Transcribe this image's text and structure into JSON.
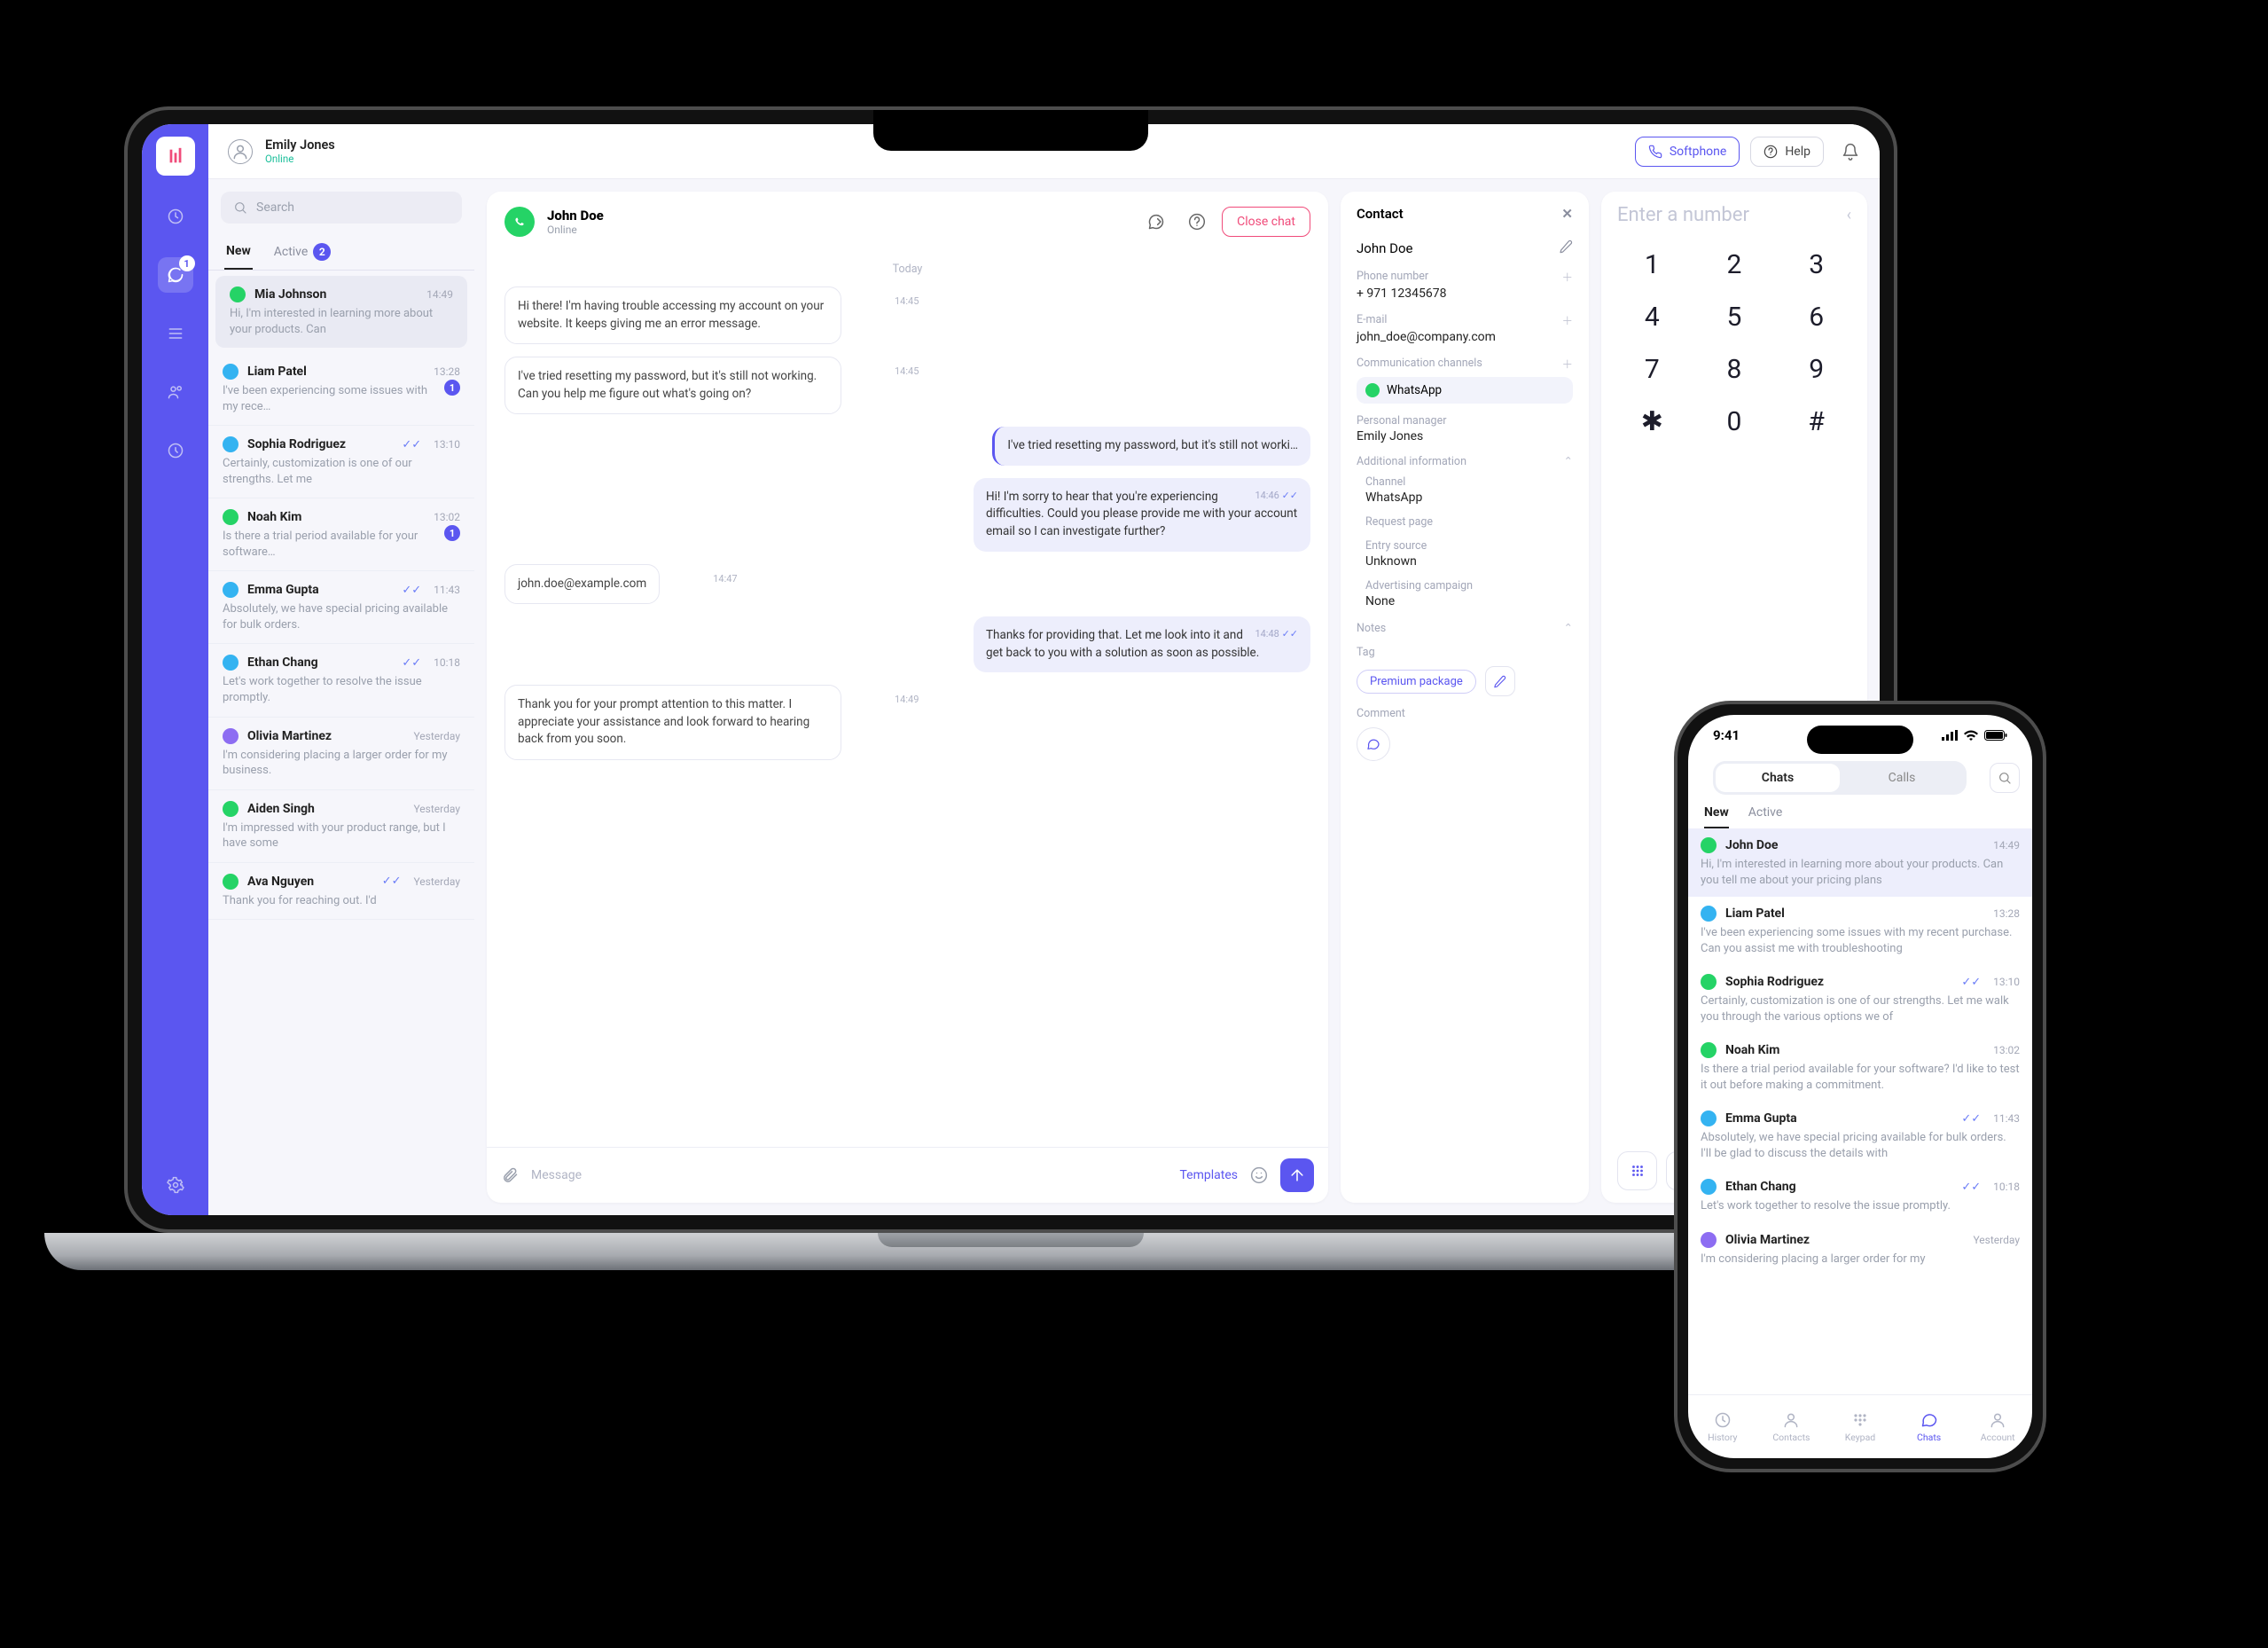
{
  "user": {
    "name": "Emily Jones",
    "status": "Online"
  },
  "topbar": {
    "softphone": "Softphone",
    "help": "Help"
  },
  "rail": {
    "badge": "1"
  },
  "search": {
    "placeholder": "Search"
  },
  "listTabs": {
    "new": "New",
    "active": "Active",
    "activeCount": "2"
  },
  "chats": [
    {
      "name": "Mia Johnson",
      "time": "14:49",
      "preview": "Hi, I'm interested in learning more about your products. Can",
      "color": "#25d366",
      "sel": true
    },
    {
      "name": "Liam Patel",
      "time": "13:28",
      "preview": "I've been experiencing some issues with my rece…",
      "color": "#34b3f1",
      "badge": "1"
    },
    {
      "name": "Sophia Rodriguez",
      "time": "13:10",
      "preview": "Certainly, customization is one of our strengths. Let me",
      "color": "#34b3f1",
      "check": true
    },
    {
      "name": "Noah Kim",
      "time": "13:02",
      "preview": "Is there a trial period available for your software…",
      "color": "#25d366",
      "badge": "1"
    },
    {
      "name": "Emma Gupta",
      "time": "11:43",
      "preview": "Absolutely, we have special pricing available for bulk orders.",
      "color": "#34b3f1",
      "check": true
    },
    {
      "name": "Ethan Chang",
      "time": "10:18",
      "preview": "Let's work together to resolve the issue promptly.",
      "color": "#34b3f1",
      "check": true
    },
    {
      "name": "Olivia Martinez",
      "time": "Yesterday",
      "preview": "I'm considering placing a larger order for my business.",
      "color": "#8d6df2"
    },
    {
      "name": "Aiden Singh",
      "time": "Yesterday",
      "preview": "I'm impressed with your product range, but I have some",
      "color": "#25d366"
    },
    {
      "name": "Ava Nguyen",
      "time": "Yesterday",
      "preview": "Thank you for reaching out. I'd",
      "color": "#25d366",
      "check": true
    }
  ],
  "chatHeader": {
    "name": "John Doe",
    "status": "Online",
    "close": "Close chat"
  },
  "daySep": "Today",
  "messages": [
    {
      "dir": "in",
      "text": "Hi there! I'm having trouble accessing my account on your website. It keeps giving me an error message.",
      "time": "14:45"
    },
    {
      "dir": "in",
      "text": "I've tried resetting my password, but it's still not working. Can you help me figure out what's going on?",
      "time": "14:45"
    },
    {
      "dir": "out",
      "text": "I've tried resetting my password, but it's still not worki…",
      "time": "",
      "bar": true
    },
    {
      "dir": "out",
      "text": "Hi! I'm sorry to hear that you're experiencing difficulties. Could you please provide me with your account email so I can investigate further?",
      "time": "14:46",
      "tick": true
    },
    {
      "dir": "in",
      "text": "john.doe@example.com",
      "time": "14:47"
    },
    {
      "dir": "out",
      "text": "Thanks for providing that. Let me look into it and get back to you with a solution as soon as possible.",
      "time": "14:48",
      "tick": true
    },
    {
      "dir": "in",
      "text": "Thank you for your prompt attention to this matter. I appreciate your assistance and look forward to hearing back from you soon.",
      "time": "14:49"
    }
  ],
  "composer": {
    "placeholder": "Message",
    "templates": "Templates"
  },
  "contact": {
    "header": "Contact",
    "name": "John Doe",
    "labels": {
      "phone": "Phone number",
      "email": "E-mail",
      "channels": "Communication channels",
      "manager": "Personal manager",
      "additional": "Additional information",
      "channel": "Channel",
      "request": "Request page",
      "entry": "Entry source",
      "ad": "Advertising campaign",
      "notes": "Notes",
      "tag": "Tag",
      "comment": "Comment"
    },
    "phone": "+ 971 12345678",
    "email": "john_doe@company.com",
    "channelChip": "WhatsApp",
    "manager": "Emily Jones",
    "channel": "WhatsApp",
    "entry": "Unknown",
    "ad": "None",
    "tag": "Premium package"
  },
  "dialer": {
    "placeholder": "Enter a number",
    "keys": [
      "1",
      "2",
      "3",
      "4",
      "5",
      "6",
      "7",
      "8",
      "9",
      "✱",
      "0",
      "#"
    ]
  },
  "phone": {
    "time": "9:41",
    "seg": {
      "chats": "Chats",
      "calls": "Calls"
    },
    "tabs": {
      "new": "New",
      "active": "Active"
    },
    "list": [
      {
        "name": "John Doe",
        "time": "14:49",
        "preview": "Hi, I'm interested in learning more about your products. Can you tell me about your pricing plans",
        "color": "#25d366",
        "sel": true
      },
      {
        "name": "Liam Patel",
        "time": "13:28",
        "preview": "I've been experiencing some issues with my recent purchase. Can you assist me with troubleshooting",
        "color": "#34b3f1"
      },
      {
        "name": "Sophia Rodriguez",
        "time": "13:10",
        "preview": "Certainly, customization is one of our strengths. Let me walk you through the various options we of",
        "color": "#25d366",
        "check": true
      },
      {
        "name": "Noah Kim",
        "time": "13:02",
        "preview": "Is there a trial period available for your software? I'd like to test it out before making a commitment.",
        "color": "#25d366"
      },
      {
        "name": "Emma Gupta",
        "time": "11:43",
        "preview": "Absolutely, we have special pricing available for bulk orders. I'll be glad to discuss the details with",
        "color": "#34b3f1",
        "check": true
      },
      {
        "name": "Ethan Chang",
        "time": "10:18",
        "preview": "Let's work together to resolve the issue promptly.",
        "color": "#34b3f1",
        "check": true
      },
      {
        "name": "Olivia Martinez",
        "time": "Yesterday",
        "preview": "I'm considering placing a larger order for my",
        "color": "#8d6df2"
      }
    ],
    "nav": {
      "history": "History",
      "contacts": "Contacts",
      "keypad": "Keypad",
      "chats": "Chats",
      "account": "Account"
    }
  }
}
